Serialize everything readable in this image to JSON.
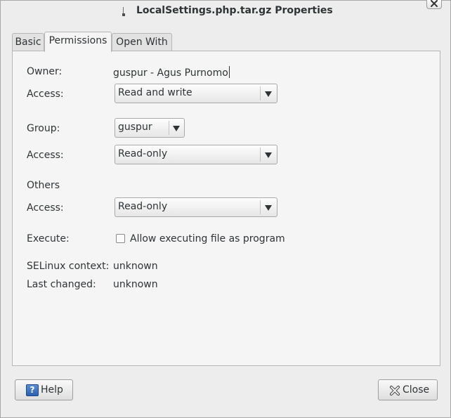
{
  "window": {
    "title": "LocalSettings.php.tar.gz Properties"
  },
  "tabs": [
    {
      "label": "Basic",
      "active": false
    },
    {
      "label": "Permissions",
      "active": true
    },
    {
      "label": "Open With",
      "active": false
    }
  ],
  "permissions": {
    "owner_label": "Owner:",
    "owner_value": "guspur - Agus Purnomo",
    "owner_access_label": "Access:",
    "owner_access_value": "Read and write",
    "group_label": "Group:",
    "group_value": "guspur",
    "group_access_label": "Access:",
    "group_access_value": "Read-only",
    "others_label": "Others",
    "others_access_label": "Access:",
    "others_access_value": "Read-only",
    "execute_label": "Execute:",
    "execute_checkbox_label": "Allow executing file as program",
    "execute_checked": false,
    "selinux_label": "SELinux context:",
    "selinux_value": "unknown",
    "last_changed_label": "Last changed:",
    "last_changed_value": "unknown"
  },
  "buttons": {
    "help_label": "Help",
    "help_icon_glyph": "?",
    "close_label": "Close"
  },
  "icons": {
    "title_icon": "file-icon",
    "window_close": "window-close-icon",
    "combo_arrow": "dropdown-arrow-icon",
    "help": "help-icon",
    "close": "close-icon"
  }
}
